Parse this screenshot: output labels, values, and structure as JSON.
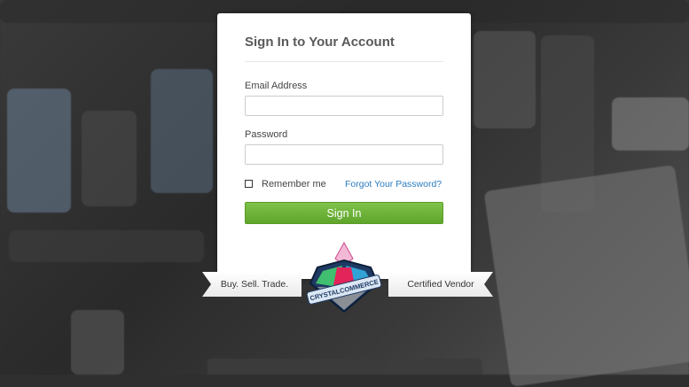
{
  "login": {
    "title": "Sign In to Your Account",
    "email_label": "Email Address",
    "email_value": "",
    "password_label": "Password",
    "password_value": "",
    "remember_label": "Remember me",
    "remember_checked": false,
    "forgot_link": "Forgot Your Password?",
    "submit_label": "Sign In"
  },
  "badge": {
    "left_text": "Buy. Sell. Trade.",
    "right_text": "Certified Vendor",
    "logo_text": "CRYSTALCOMMERCE",
    "logo_icon": "crystal-gem-icon"
  },
  "colors": {
    "button": "#6bb33a",
    "link": "#2b7cbf"
  }
}
